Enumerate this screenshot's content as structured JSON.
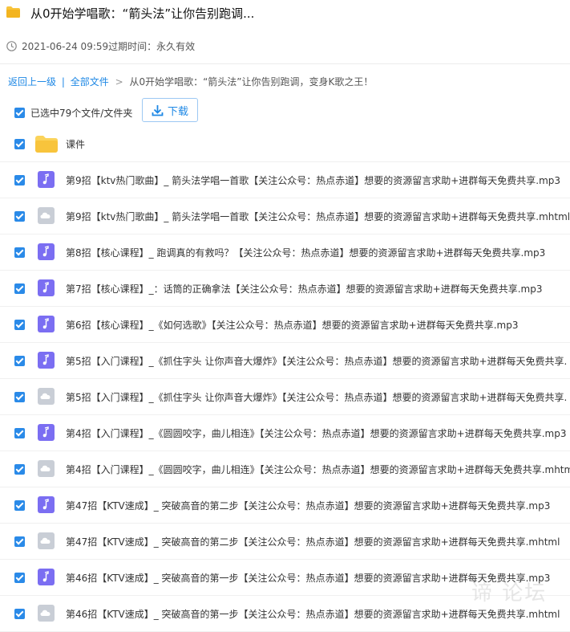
{
  "header": {
    "title": "从0开始学唱歌：“箭头法”让你告别跑调...",
    "meta": "2021-06-24 09:59过期时间：永久有效"
  },
  "breadcrumb": {
    "back": "返回上一级",
    "all": "全部文件",
    "separator": ">",
    "current": "从0开始学唱歌：“箭头法”让你告别跑调，变身K歌之王！"
  },
  "selection": {
    "text": "已选中79个文件/文件夹",
    "download": "下载"
  },
  "files": [
    {
      "type": "folder",
      "name": "课件"
    },
    {
      "type": "music",
      "name": "第9招【ktv热门歌曲】_ 箭头法学唱一首歌【关注公众号：热点赤道】想要的资源留言求助+进群每天免费共享.mp3"
    },
    {
      "type": "cloud",
      "name": "第9招【ktv热门歌曲】_ 箭头法学唱一首歌【关注公众号：热点赤道】想要的资源留言求助+进群每天免费共享.mhtml"
    },
    {
      "type": "music",
      "name": "第8招【核心课程】_ 跑调真的有救吗？【关注公众号：热点赤道】想要的资源留言求助+进群每天免费共享.mp3"
    },
    {
      "type": "music",
      "name": "第7招【核心课程】_：话筒的正确拿法【关注公众号：热点赤道】想要的资源留言求助+进群每天免费共享.mp3"
    },
    {
      "type": "music",
      "name": "第6招【核心课程】_《如何选歌》【关注公众号：热点赤道】想要的资源留言求助+进群每天免费共享.mp3"
    },
    {
      "type": "music",
      "name": "第5招【入门课程】_《抓住字头 让你声音大爆炸》【关注公众号：热点赤道】想要的资源留言求助+进群每天免费共享."
    },
    {
      "type": "cloud",
      "name": "第5招【入门课程】_《抓住字头 让你声音大爆炸》【关注公众号：热点赤道】想要的资源留言求助+进群每天免费共享."
    },
    {
      "type": "music",
      "name": "第4招【入门课程】_《圆圆咬字，曲儿相连》【关注公众号：热点赤道】想要的资源留言求助+进群每天免费共享.mp3"
    },
    {
      "type": "cloud",
      "name": "第4招【入门课程】_《圆圆咬字，曲儿相连》【关注公众号：热点赤道】想要的资源留言求助+进群每天免费共享.mhtm"
    },
    {
      "type": "music",
      "name": "第47招【KTV速成】_ 突破高音的第二步【关注公众号：热点赤道】想要的资源留言求助+进群每天免费共享.mp3"
    },
    {
      "type": "cloud",
      "name": "第47招【KTV速成】_ 突破高音的第二步【关注公众号：热点赤道】想要的资源留言求助+进群每天免费共享.mhtml"
    },
    {
      "type": "music",
      "name": "第46招【KTV速成】_ 突破高音的第一步【关注公众号：热点赤道】想要的资源留言求助+进群每天免费共享.mp3"
    },
    {
      "type": "cloud",
      "name": "第46招【KTV速成】_ 突破高音的第一步【关注公众号：热点赤道】想要的资源留言求助+进群每天免费共享.mhtml"
    }
  ],
  "colors": {
    "accent": "#1e88e5",
    "checkbox": "#2a8ae8",
    "music_icon": "#7b6ef2",
    "cloud_icon": "#c9ced6",
    "folder": "#f8c43c"
  },
  "watermark": "谛 论坛"
}
